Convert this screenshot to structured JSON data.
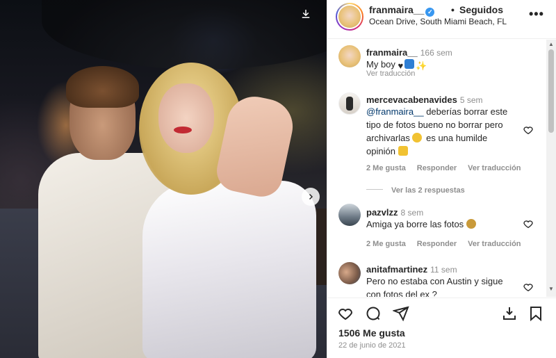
{
  "header": {
    "username": "franmaira__",
    "separator": "•",
    "follow_status": "Seguidos",
    "location": "Ocean Drive, South Miami Beach, FL",
    "more_icon": "more-horizontal-icon"
  },
  "caption": {
    "username": "franmaira__",
    "time": "166 sem",
    "text": "My boy",
    "translate": "Ver traducción"
  },
  "comments": [
    {
      "username": "mercevacabenavides",
      "time": "5 sem",
      "mention": "@franmaira__",
      "text_line1": " deberías borrar este",
      "text_line2": "tipo de fotos bueno no borrar pero",
      "text_line3": "archivarlas",
      "text_line3b": " es una humilde",
      "text_line4": "opinión",
      "likes": "2 Me gusta",
      "reply": "Responder",
      "translate": "Ver traducción",
      "view_replies": "Ver las 2 respuestas"
    },
    {
      "username": "pazvlzz",
      "time": "8 sem",
      "text": "Amiga ya borre las fotos",
      "likes": "2 Me gusta",
      "reply": "Responder",
      "translate": "Ver traducción"
    },
    {
      "username": "anitafmartinez",
      "time": "11 sem",
      "text_line1": "Pero no estaba con Austin y sigue",
      "text_line2": "con fotos del ex ?"
    }
  ],
  "footer": {
    "likes": "1506 Me gusta",
    "date": "22 de junio de 2021"
  },
  "colors": {
    "accent_blue": "#3897f0",
    "link_blue": "#00376b",
    "muted": "#8e8e8e"
  }
}
